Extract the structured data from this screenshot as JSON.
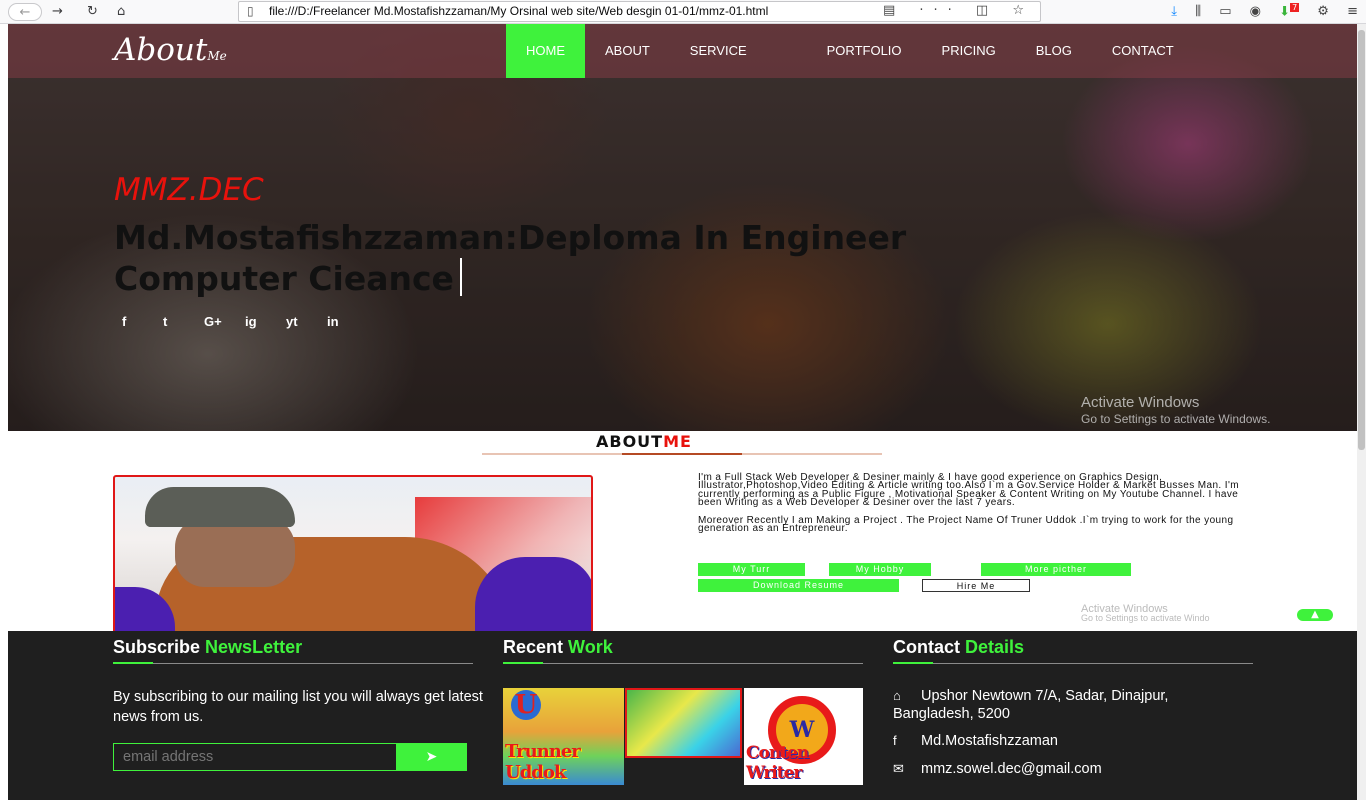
{
  "browser": {
    "url": "file:///D:/Freelancer Md.Mostafishzzaman/My Orsinal web site/Web desgin 01-01/mmz-01.html",
    "url_icons": "▤ ··· ◫ ☆",
    "notification_count": "7"
  },
  "nav": {
    "logo": "About",
    "logo_sub": "Me",
    "items": [
      "HOME",
      "ABOUT",
      "SERVICE",
      "PORTFOLIO",
      "PRICING",
      "BLOG",
      "CONTACT"
    ],
    "active": "HOME",
    "accent_color": "#3ff23c"
  },
  "hero": {
    "kicker": "MMZ.DEC",
    "title": "Md.Mostafishzzaman:Deploma In Engineer Computer Cieance",
    "social": [
      "f",
      "t",
      "G+",
      "ig",
      "yt",
      "in"
    ],
    "watermark_1": "Activate Windows",
    "watermark_2": "Go to Settings to activate Windows."
  },
  "about": {
    "heading_main": "ABOUT",
    "heading_accent": "ME",
    "paragraph_1": "I'm a Full Stack Web Developer & Desiner mainly & I have good experience on Graphics Design, Illustrator,Photoshop,Video Editing & Article writing too.Also I`m a Gov.Service Holder & Market Busses Man. I'm currently performing as a Public Figure , Motivational Speaker & Content Writing on My Youtube Channel. I have been Writing as a Web Developer & Desiner over the last 7 years.",
    "paragraph_2": "Moreover Recently I am Making a Project . The Project Name Of Truner Uddok .I`m trying to work for the young generation as an Entrepreneur.",
    "buttons": {
      "turr": "My Turr",
      "hobby": "My Hobby",
      "more": "More picther",
      "resume": "Download Resume",
      "hire": "Hire Me"
    },
    "watermark_1": "Activate Windows",
    "watermark_2": "Go to Settings to activate Windo"
  },
  "footer": {
    "subscribe": {
      "title_main": "Subscribe",
      "title_accent": "NewsLetter",
      "text": "By subscribing to our mailing list you will always get latest news from us.",
      "placeholder": "email address"
    },
    "recent": {
      "title_main": "Recent",
      "title_accent": "Work",
      "thumb_1_caption": "Trunner Uddok",
      "thumb_3_caption": "Conten Writer"
    },
    "contact": {
      "title_main": "Contact",
      "title_accent": "Details",
      "address": "Upshor Newtown 7/A, Sadar, Dinajpur, Bangladesh, 5200",
      "facebook": "Md.Mostafishzzaman",
      "email": "mmz.sowel.dec@gmail.com"
    }
  }
}
